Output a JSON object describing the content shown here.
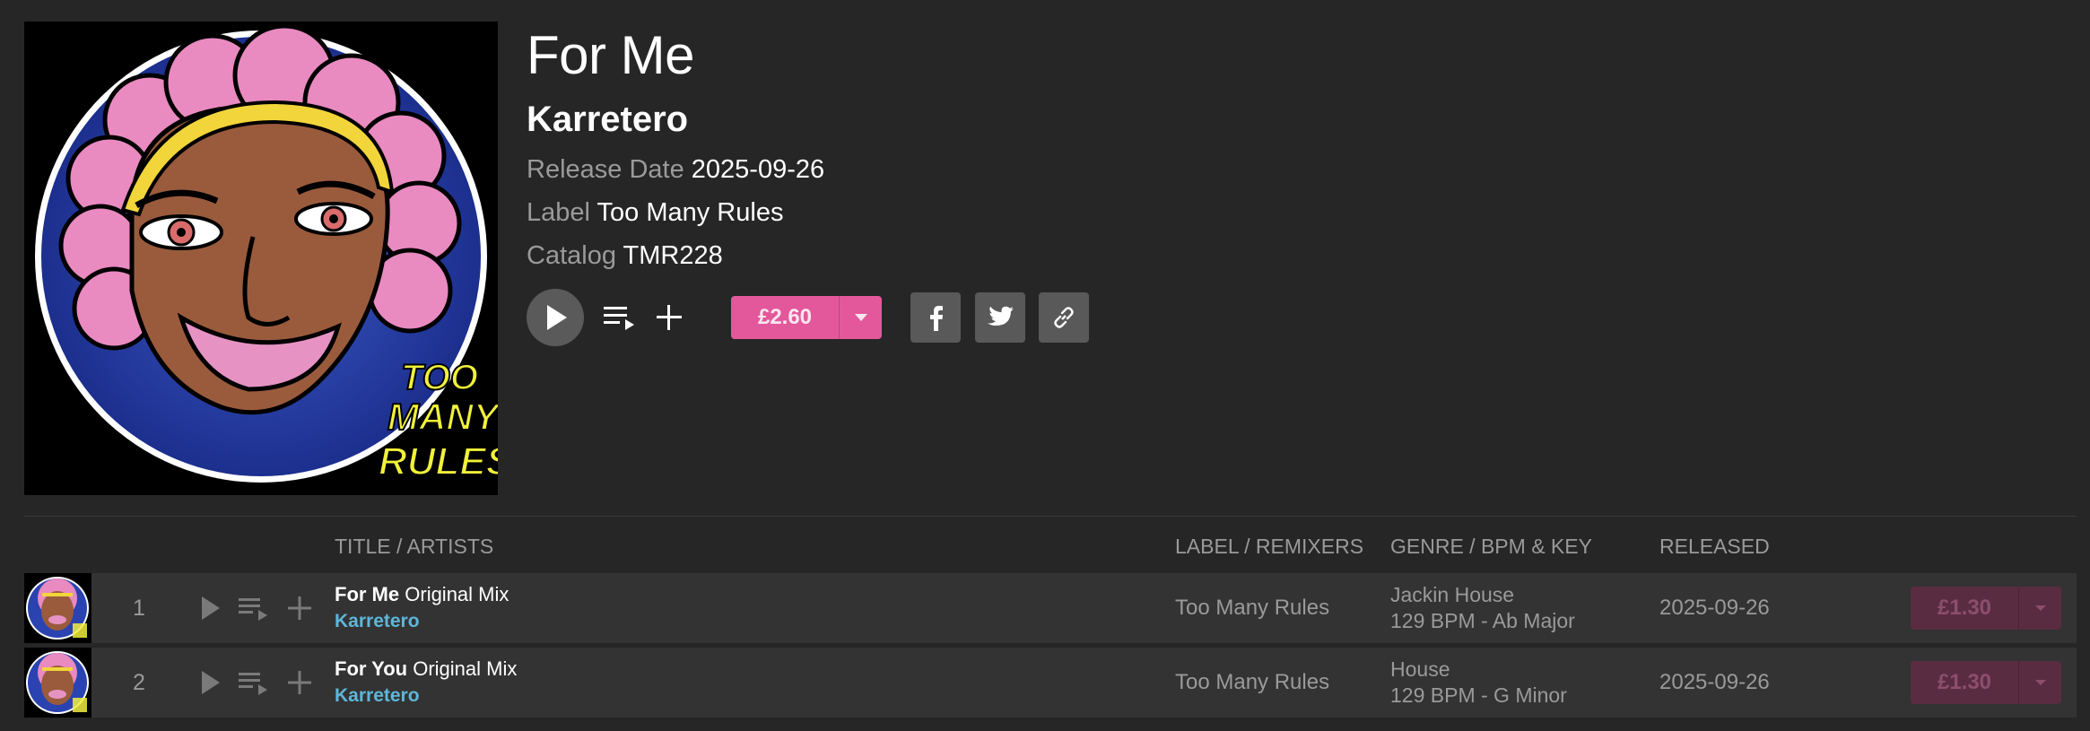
{
  "release": {
    "title": "For Me",
    "artist": "Karretero",
    "release_date_label": "Release Date",
    "release_date": "2025-09-26",
    "label_label": "Label",
    "label": "Too Many Rules",
    "catalog_label": "Catalog",
    "catalog": "TMR228",
    "price": "£2.60",
    "artwork_text": [
      "TOO",
      "MANY",
      "RULES"
    ]
  },
  "icons": {
    "play": "play-icon",
    "queue": "add-to-queue-icon",
    "add": "plus-icon",
    "dropdown": "chevron-down-icon",
    "facebook": "facebook-icon",
    "twitter": "twitter-icon",
    "link": "link-icon"
  },
  "colors": {
    "background": "#262626",
    "row_background": "#333333",
    "accent_pink": "#e3589b",
    "disabled_pink": "#5a2c42",
    "artist_link": "#5fb6d9",
    "muted_text": "#9a9a9a"
  },
  "table": {
    "headers": {
      "title": "TITLE / ARTISTS",
      "label": "LABEL / REMIXERS",
      "genre": "GENRE / BPM & KEY",
      "released": "RELEASED"
    },
    "tracks": [
      {
        "number": "1",
        "name": "For Me",
        "mix": "Original Mix",
        "artist": "Karretero",
        "label": "Too Many Rules",
        "genre": "Jackin House",
        "bpm_key": "129 BPM - Ab Major",
        "released": "2025-09-26",
        "price": "£1.30"
      },
      {
        "number": "2",
        "name": "For You",
        "mix": "Original Mix",
        "artist": "Karretero",
        "label": "Too Many Rules",
        "genre": "House",
        "bpm_key": "129 BPM - G Minor",
        "released": "2025-09-26",
        "price": "£1.30"
      }
    ]
  }
}
